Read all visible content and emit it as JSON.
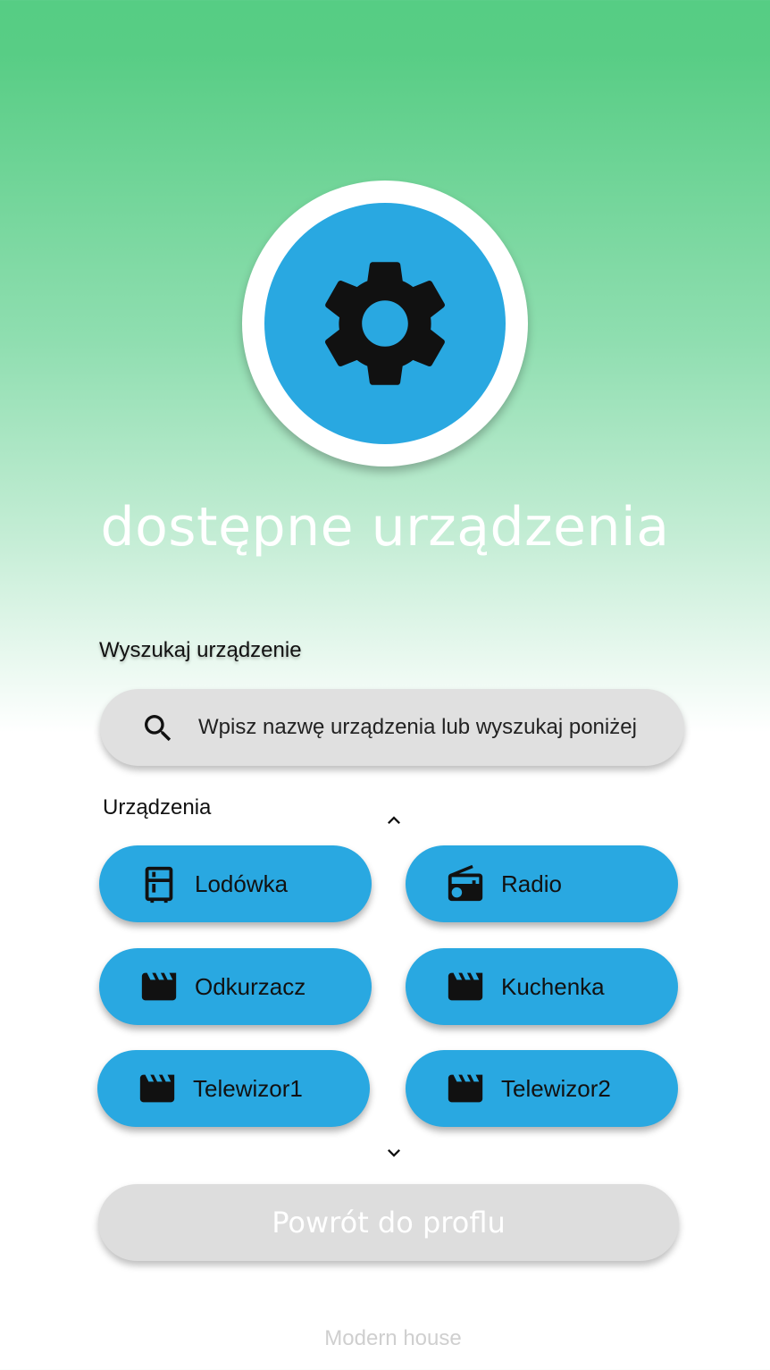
{
  "header": {
    "title": "dostępne urządzenia"
  },
  "search": {
    "label": "Wyszukaj urządzenie",
    "placeholder": "Wpisz nazwę urządzenia lub wyszukaj poniżej",
    "value": ""
  },
  "devices": {
    "label": "Urządzenia",
    "items": [
      {
        "label": "Lodówka",
        "icon": "fridge-icon"
      },
      {
        "label": "Radio",
        "icon": "radio-icon"
      },
      {
        "label": "Odkurzacz",
        "icon": "clapperboard-icon"
      },
      {
        "label": "Kuchenka",
        "icon": "clapperboard-icon"
      },
      {
        "label": "Telewizor1",
        "icon": "clapperboard-icon"
      },
      {
        "label": "Telewizor2",
        "icon": "clapperboard-icon"
      }
    ]
  },
  "actions": {
    "back_label": "Powrót do proflu"
  },
  "footer": {
    "text": "Modern house"
  },
  "colors": {
    "accent": "#29a8e1",
    "gradient_top": "#56cd84",
    "button_disabled": "#dddddd"
  }
}
